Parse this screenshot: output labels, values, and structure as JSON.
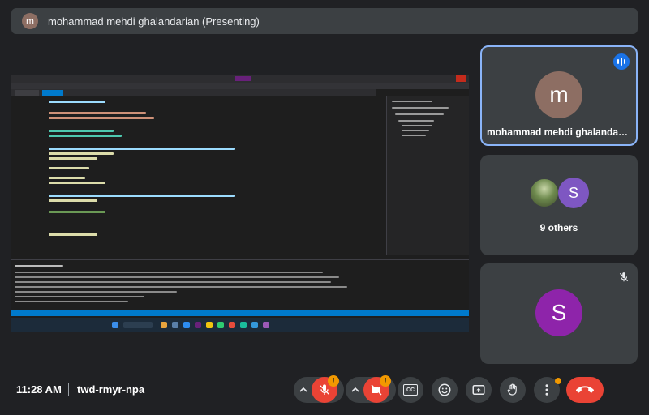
{
  "presenter_banner": {
    "avatar_letter": "m",
    "text": "mohammad mehdi ghalandarian (Presenting)"
  },
  "shared_screen": {
    "content": "Visual Studio code editor"
  },
  "tiles": [
    {
      "avatar_letter": "m",
      "name": "mohammad mehdi ghalandari...",
      "avatar_color": "#8d6e63",
      "speaking": true
    },
    {
      "avatar_letter": "S",
      "name": "9 others",
      "avatar_color": "#7e57c2"
    },
    {
      "avatar_letter": "S",
      "avatar_color": "#8e24aa",
      "muted": true
    }
  ],
  "footer": {
    "time": "11:28 AM",
    "meeting_code": "twd-rmyr-npa"
  },
  "controls": {
    "mic_badge": "!",
    "camera_badge": "!",
    "captions_label": "CC"
  },
  "colors": {
    "background": "#202124",
    "tile": "#3c4043",
    "accent": "#8ab4f8",
    "danger": "#ea4335",
    "warning": "#f29900"
  },
  "icons": [
    "mic-off-icon",
    "camera-off-icon",
    "captions-icon",
    "emoji-icon",
    "present-icon",
    "raise-hand-icon",
    "more-options-icon",
    "leave-call-icon",
    "chevron-up-icon",
    "speaking-icon",
    "mute-icon"
  ]
}
